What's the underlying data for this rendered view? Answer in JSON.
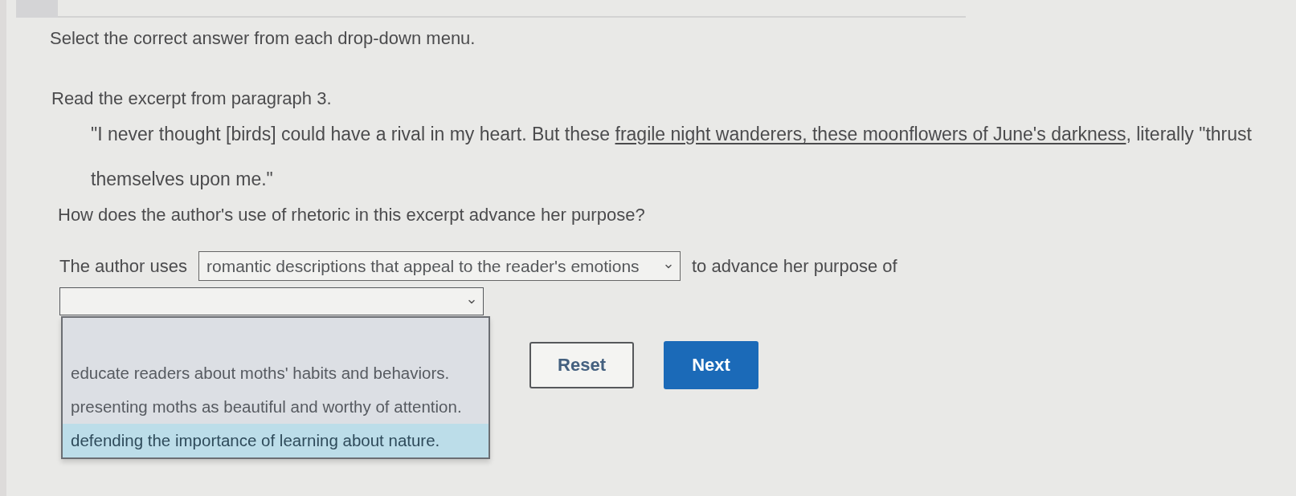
{
  "instruction": "Select the correct answer from each drop-down menu.",
  "prompt": "Read the excerpt from paragraph 3.",
  "excerpt": [
    {
      "text": "\"I never thought [birds] could have a rival in my heart. But these ",
      "underlined": false
    },
    {
      "text": "fragile night wanderers, these moonflowers of June's darkness",
      "underlined": true
    },
    {
      "text": ", literally \"thrust themselves upon me.\"",
      "underlined": false
    }
  ],
  "question": "How does the author's use of rhetoric in this excerpt advance her purpose?",
  "answer_sentence": [
    {
      "kind": "text",
      "text": "The author uses"
    },
    {
      "kind": "dropdown",
      "value": "romantic descriptions that appeal to the reader's emotions",
      "expanded": false
    },
    {
      "kind": "text",
      "text": "to advance her purpose of"
    },
    {
      "kind": "dropdown",
      "expanded": true,
      "options": [
        {
          "text": "educate readers about moths' habits and behaviors.",
          "highlighted": false
        },
        {
          "text": "presenting moths as beautiful and worthy of attention.",
          "highlighted": false
        },
        {
          "text": "defending the importance of learning about nature.",
          "highlighted": true
        }
      ]
    }
  ],
  "buttons": [
    {
      "label": "Reset",
      "kind": "secondary"
    },
    {
      "label": "Next",
      "kind": "primary"
    }
  ]
}
